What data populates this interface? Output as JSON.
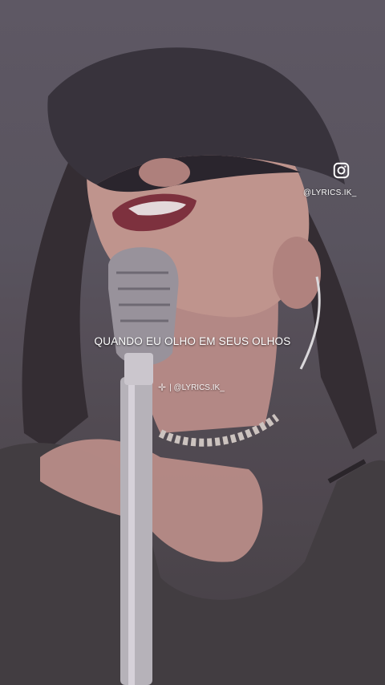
{
  "overlay": {
    "instagram_icon": "instagram-icon",
    "handle": "@LYRICS.IK_",
    "lyric": "QUANDO EU OLHO EM SEUS OLHOS",
    "watermark": "| @LYRICS.IK_",
    "watermark_glyph": "✛"
  },
  "colors": {
    "text": "#ffffff",
    "background": "#55515a",
    "cap": "#2f2c33",
    "skin": "#c99a8f",
    "lips": "#7e2a35"
  }
}
